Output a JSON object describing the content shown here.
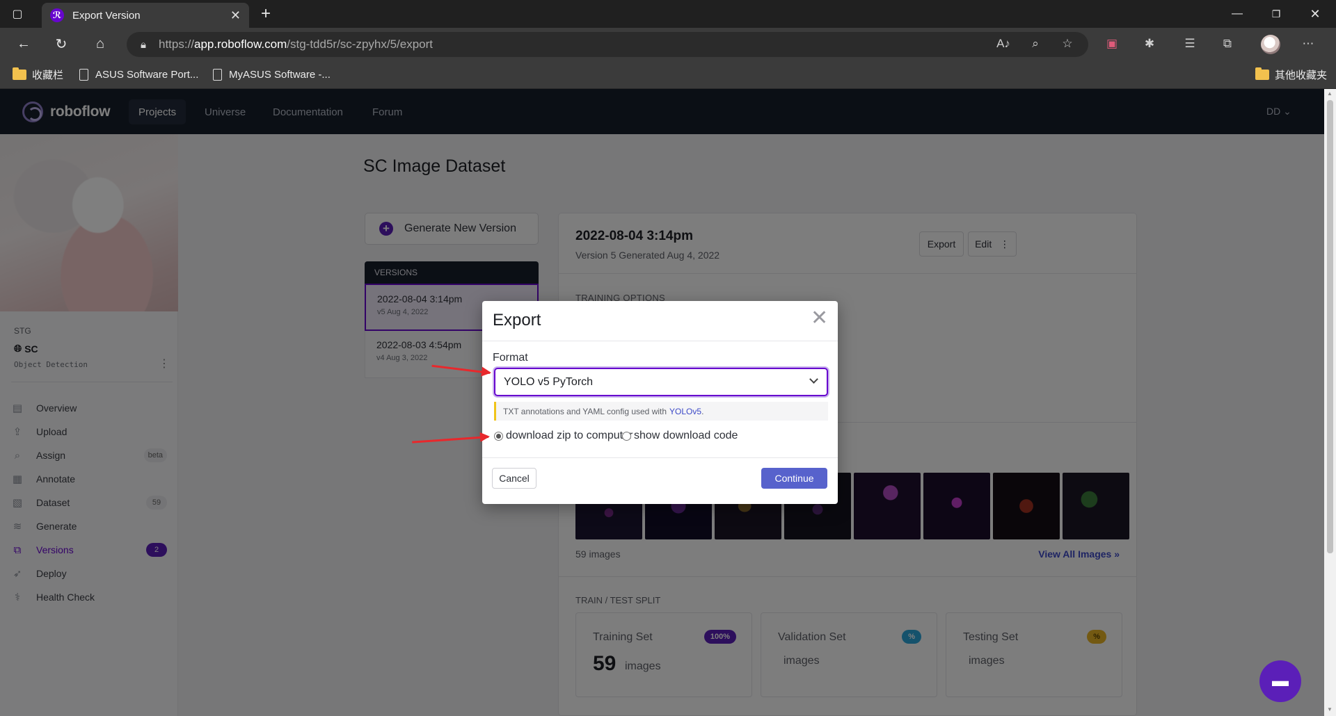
{
  "browser": {
    "tab_title": "Export Version",
    "tab_close": "✕",
    "new_tab": "+",
    "url_prefix": "https://",
    "url_host": "app.roboflow.com",
    "url_path": "/stg-tdd5r/sc-zpyhx/5/export",
    "window_controls": [
      "minimize-icon",
      "restore-icon",
      "close-icon"
    ],
    "bookmarks": [
      {
        "label": "收藏栏",
        "icon": "folder-icon"
      },
      {
        "label": "ASUS Software Port...",
        "icon": "page-icon"
      },
      {
        "label": "MyASUS Software -...",
        "icon": "page-icon"
      }
    ],
    "other_bookmarks": "其他收藏夹"
  },
  "app": {
    "logo_text": "roboflow",
    "nav": [
      {
        "label": "Projects",
        "active": true
      },
      {
        "label": "Universe",
        "active": false
      },
      {
        "label": "Documentation",
        "active": false
      },
      {
        "label": "Forum",
        "active": false
      }
    ],
    "user_label": "DD"
  },
  "sidebar": {
    "workspace": "STG",
    "project_name": "SC",
    "project_type": "Object Detection",
    "items": [
      {
        "label": "Overview",
        "icon": "overview-icon",
        "badge": ""
      },
      {
        "label": "Upload",
        "icon": "upload-icon",
        "badge": ""
      },
      {
        "label": "Assign",
        "icon": "search-icon",
        "badge": "beta"
      },
      {
        "label": "Annotate",
        "icon": "annotate-icon",
        "badge": ""
      },
      {
        "label": "Dataset",
        "icon": "images-icon",
        "badge": "59"
      },
      {
        "label": "Generate",
        "icon": "layers-icon",
        "badge": ""
      },
      {
        "label": "Versions",
        "icon": "versions-icon",
        "badge": "2",
        "active": true
      },
      {
        "label": "Deploy",
        "icon": "rocket-icon",
        "badge": ""
      },
      {
        "label": "Health Check",
        "icon": "stethoscope-icon",
        "badge": ""
      }
    ]
  },
  "main": {
    "page_title": "SC Image Dataset",
    "generate_button": "Generate New Version",
    "versions_header": "VERSIONS",
    "versions": [
      {
        "date": "2022-08-04 3:14pm",
        "sub": "v5 Aug 4, 2022",
        "active": true
      },
      {
        "date": "2022-08-03 4:54pm",
        "sub": "v4 Aug 3, 2022",
        "active": false
      }
    ],
    "detail": {
      "title": "2022-08-04 3:14pm",
      "subtitle": "Version 5 Generated Aug 4, 2022",
      "export_button": "Export",
      "edit_button": "Edit",
      "edit_menu": "⋮",
      "training_options_label": "TRAINING OPTIONS",
      "images_count": "59 images",
      "view_all": "View All Images »",
      "split_label": "TRAIN / TEST SPLIT",
      "splits": [
        {
          "title": "Training Set",
          "pct": "100%",
          "count": "59",
          "unit": "images",
          "color": "#5b1fb8"
        },
        {
          "title": "Validation Set",
          "pct": "%",
          "count": "",
          "unit": "images",
          "color": "#2aa4d8"
        },
        {
          "title": "Testing Set",
          "pct": "%",
          "count": "",
          "unit": "images",
          "color": "#e6b325"
        }
      ]
    }
  },
  "modal": {
    "title": "Export",
    "close": "✕",
    "format_label": "Format",
    "format_value": "YOLO v5 PyTorch",
    "hint_text": "TXT annotations and YAML config used with",
    "hint_link": "YOLOv5",
    "hint_suffix": ".",
    "radio_options": [
      {
        "label": "download zip to computer",
        "checked": true
      },
      {
        "label": "show download code",
        "checked": false
      }
    ],
    "cancel": "Cancel",
    "continue": "Continue"
  },
  "colors": {
    "brand_purple": "#6706ce",
    "continue_button": "#5762cc",
    "nav_bg": "#171e2b",
    "annotation_arrow": "#e8282c"
  }
}
